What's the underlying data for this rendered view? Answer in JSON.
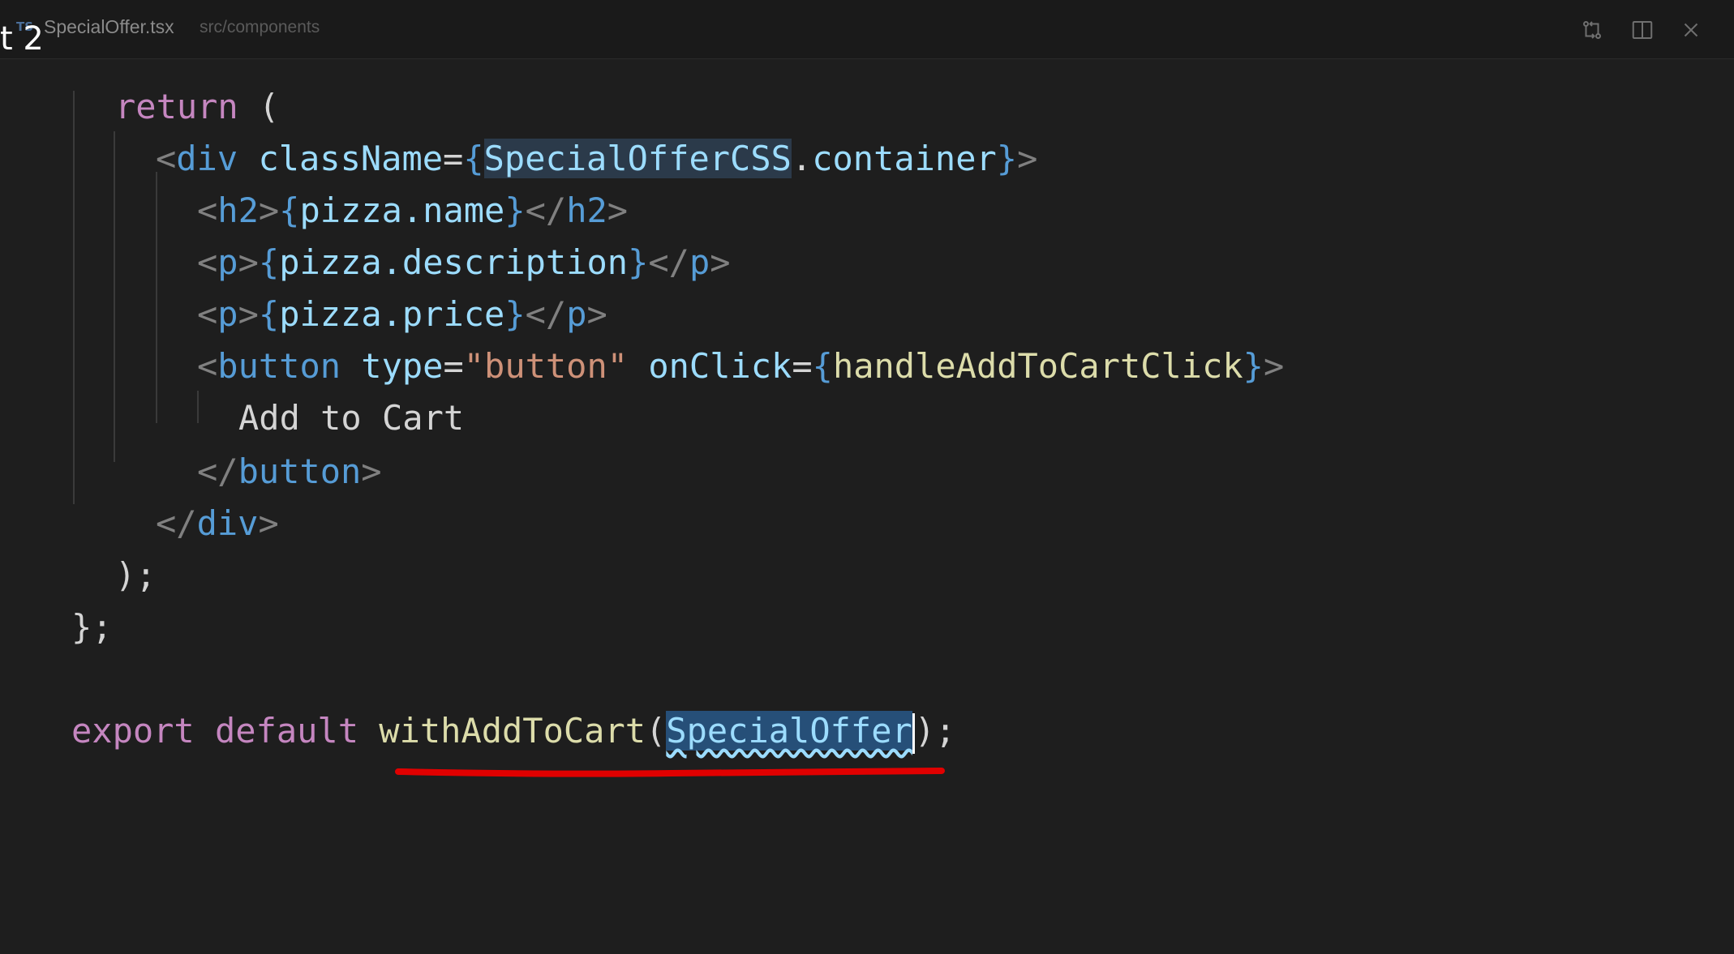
{
  "overlay": {
    "text": "t 2"
  },
  "tab": {
    "icon": "TS",
    "file_name": "SpecialOffer.tsx",
    "path": "src/components"
  },
  "controls": [
    "compare-changes-icon",
    "split-editor-icon",
    "close-icon"
  ],
  "code": {
    "l1": {
      "kw": "return",
      "rest": " ("
    },
    "l2": {
      "lt": "<",
      "tag": "div",
      "attr": " className",
      "eq": "=",
      "ob": "{",
      "ident1": "SpecialOfferCSS",
      "dot": ".",
      "ident2": "container",
      "cb": "}",
      "gt": ">"
    },
    "l3": {
      "lt": "<",
      "tag": "h2",
      "gt": ">",
      "ob": "{",
      "expr": "pizza.name",
      "cb": "}",
      "clt": "</",
      "ctag": "h2",
      "cgt": ">"
    },
    "l4": {
      "lt": "<",
      "tag": "p",
      "gt": ">",
      "ob": "{",
      "expr": "pizza.description",
      "cb": "}",
      "clt": "</",
      "ctag": "p",
      "cgt": ">"
    },
    "l5": {
      "lt": "<",
      "tag": "p",
      "gt": ">",
      "ob": "{",
      "expr": "pizza.price",
      "cb": "}",
      "clt": "</",
      "ctag": "p",
      "cgt": ">"
    },
    "l6": {
      "lt": "<",
      "tag": "button",
      "attr1": " type",
      "eq1": "=",
      "str": "\"button\"",
      "attr2": " onClick",
      "eq2": "=",
      "ob": "{",
      "handler": "handleAddToCartClick",
      "cb": "}",
      "gt": ">"
    },
    "l7": {
      "text": "Add to Cart"
    },
    "l8": {
      "lt": "</",
      "tag": "button",
      "gt": ">"
    },
    "l9": {
      "lt": "</",
      "tag": "div",
      "gt": ">"
    },
    "l10": {
      "text": ");"
    },
    "l11": {
      "text": "};"
    },
    "l12": {
      "kw1": "export",
      "kw2": " default",
      "fn": " withAddToCart",
      "op": "(",
      "arg": "SpecialOffer",
      "close": ");"
    }
  },
  "colors": {
    "annotation_underline": "#e00000",
    "background": "#1e1e1e"
  }
}
